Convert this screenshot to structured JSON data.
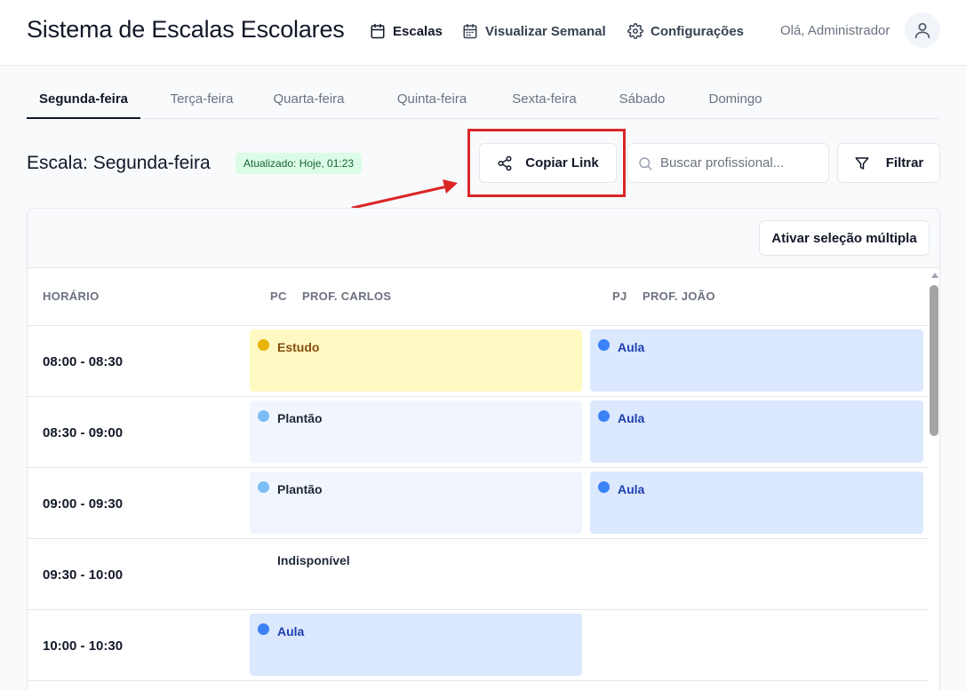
{
  "header": {
    "title": "Sistema de Escalas Escolares",
    "nav": [
      {
        "label": "Escalas",
        "icon": "calendar-icon"
      },
      {
        "label": "Visualizar Semanal",
        "icon": "calendar-week-icon"
      },
      {
        "label": "Configurações",
        "icon": "gear-icon"
      }
    ],
    "greeting": "Olá, Administrador",
    "avatar_icon": "user-icon"
  },
  "tabs": [
    "Segunda-feira",
    "Terça-feira",
    "Quarta-feira",
    "Quinta-feira",
    "Sexta-feira",
    "Sábado",
    "Domingo"
  ],
  "active_tab": "Segunda-feira",
  "toolbar": {
    "schedule_title": "Escala: Segunda-feira",
    "updated_badge": "Atualizado: Hoje, 01:23",
    "copy_link_label": "Copiar Link",
    "search_placeholder": "Buscar profissional...",
    "filter_label": "Filtrar"
  },
  "table": {
    "multi_select_label": "Ativar seleção múltipla",
    "headers": {
      "time": "HORÁRIO",
      "col1_initials": "PC",
      "col1_name": "PROF. CARLOS",
      "col2_initials": "PJ",
      "col2_name": "PROF. JOÃO"
    },
    "rows": [
      {
        "time": "08:00 - 08:30",
        "carlos": "Estudo",
        "joao": "Aula"
      },
      {
        "time": "08:30 - 09:00",
        "carlos": "Plantão",
        "joao": "Aula"
      },
      {
        "time": "09:00 - 09:30",
        "carlos": "Plantão",
        "joao": "Aula"
      },
      {
        "time": "09:30 - 10:00",
        "carlos": "Indisponível",
        "joao": ""
      },
      {
        "time": "10:00 - 10:30",
        "carlos": "Aula",
        "joao": ""
      }
    ]
  },
  "colors": {
    "estudo": "#eab308",
    "aula": "#3b82f6",
    "plantao": "#7dbdf6",
    "annotation": "#dc2626",
    "badge_bg": "#dcfce7"
  }
}
